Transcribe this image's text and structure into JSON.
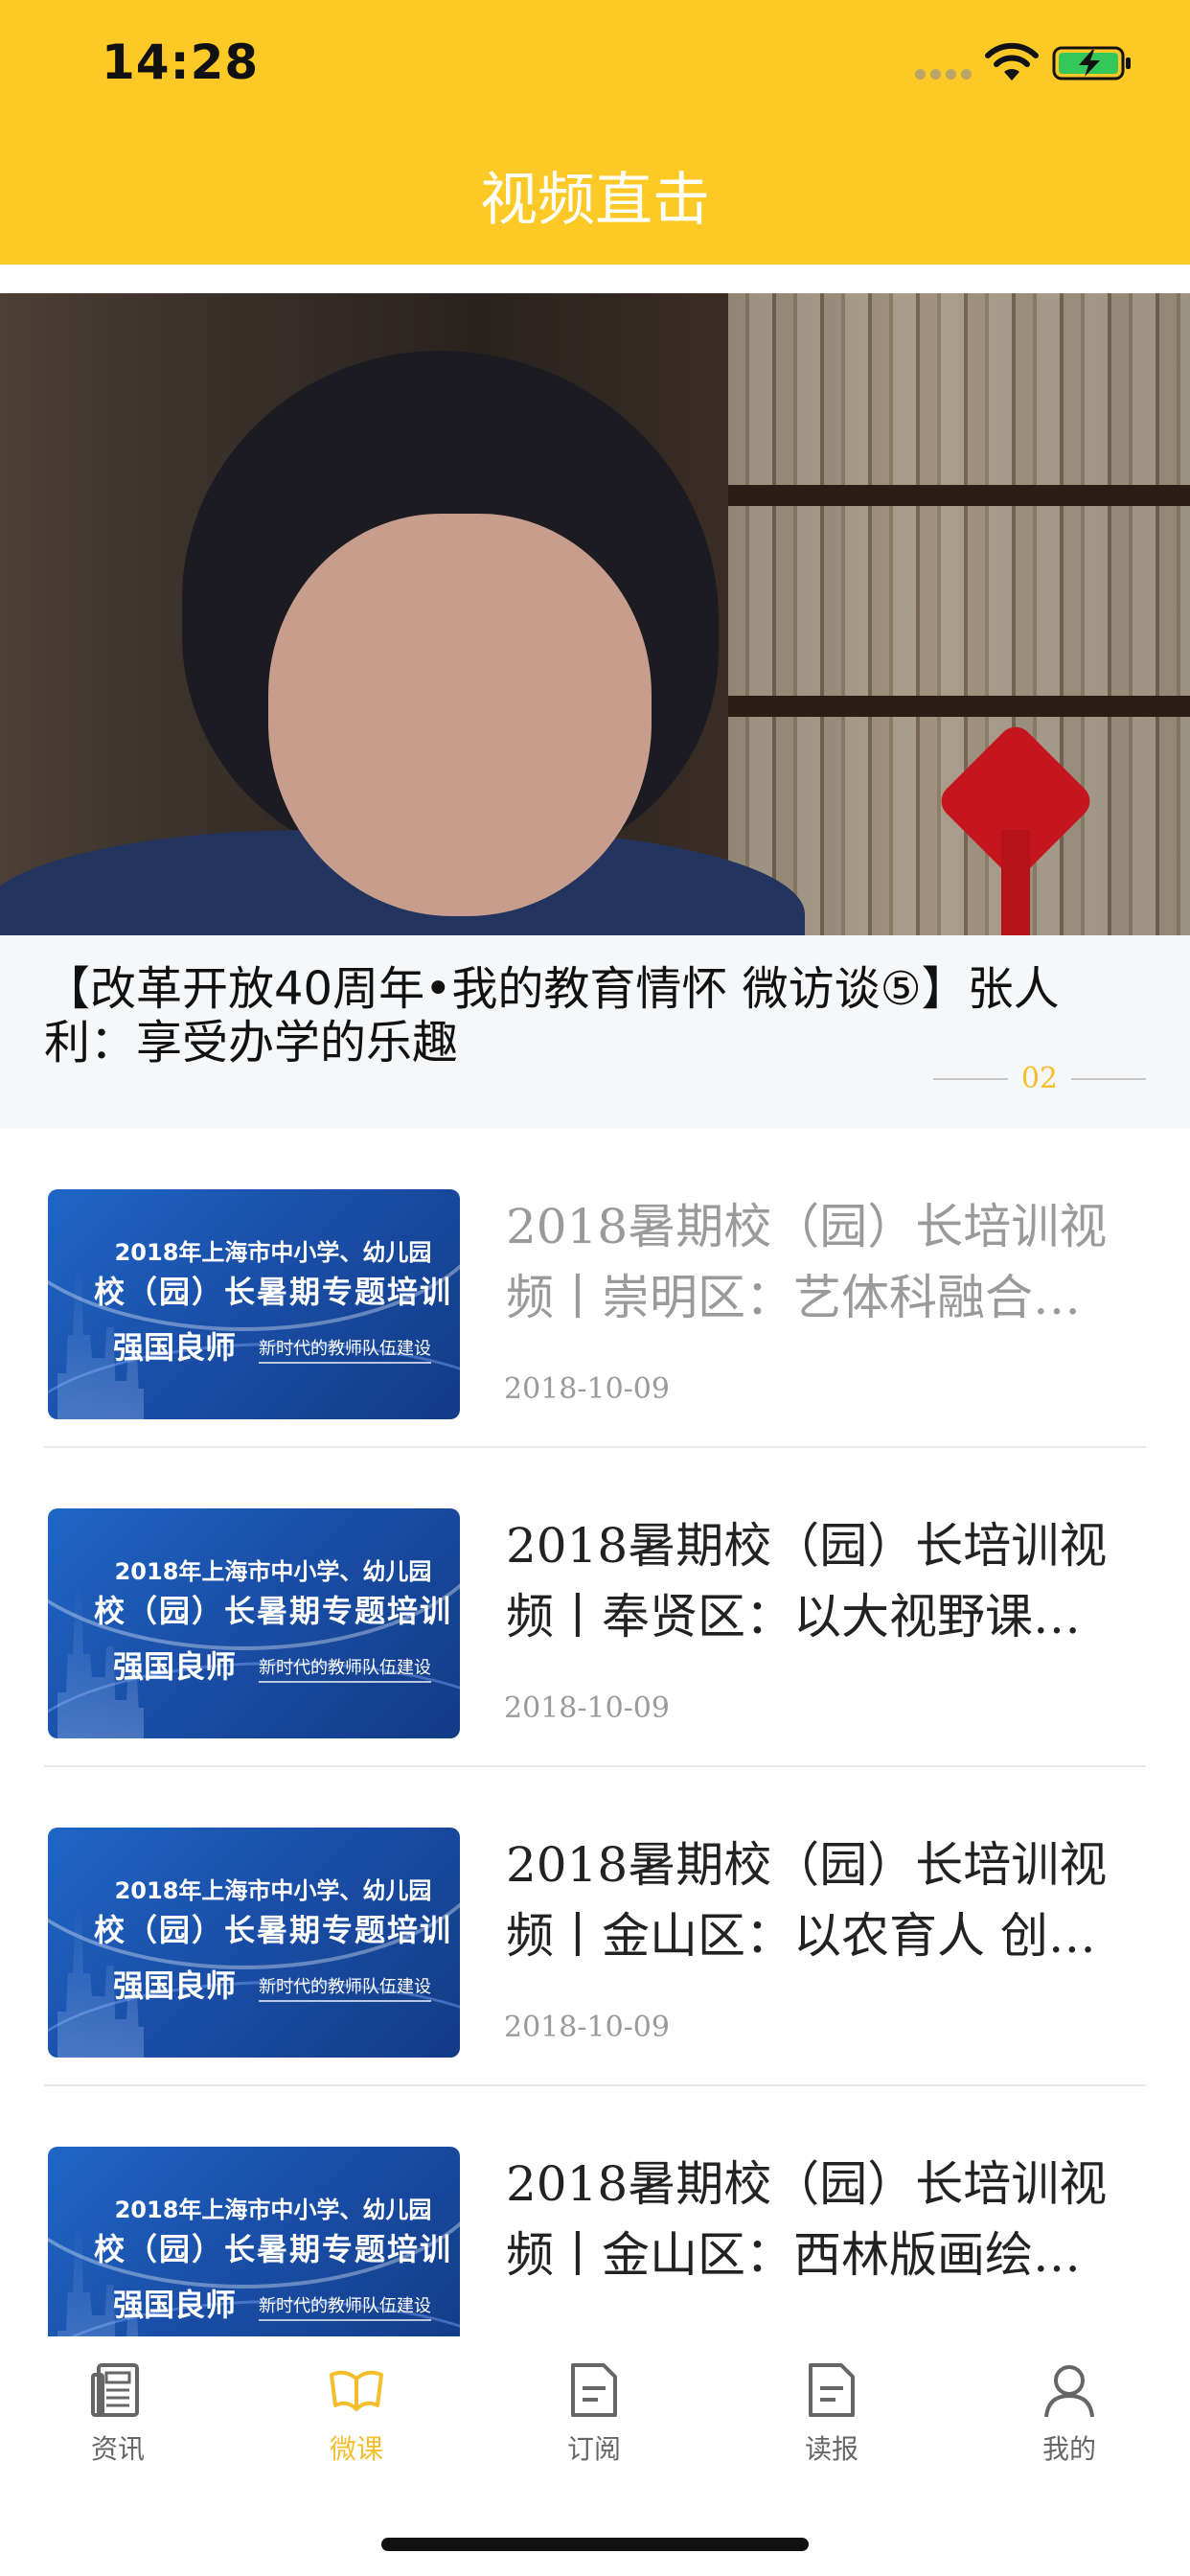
{
  "status_bar": {
    "time": "14:28"
  },
  "header": {
    "title": "视频直击"
  },
  "featured": {
    "title": "【改革开放40周年•我的教育情怀 微访谈⑤】张人利：享受办学的乐趣",
    "page_number": "02"
  },
  "thumbnail": {
    "line1": "2018年上海市中小学、幼儿园",
    "line2": "校（园）长暑期专题培训",
    "line3": "强国良师",
    "line4": "新时代的教师队伍建设"
  },
  "list": [
    {
      "title_line1": "2018暑期校（园）长培训视",
      "title_line2": "频丨崇明区：艺体科融合…",
      "date": "2018-10-09",
      "read": true
    },
    {
      "title_line1": "2018暑期校（园）长培训视",
      "title_line2": "频丨奉贤区：以大视野课…",
      "date": "2018-10-09",
      "read": false
    },
    {
      "title_line1": "2018暑期校（园）长培训视",
      "title_line2": "频丨金山区：以农育人 创…",
      "date": "2018-10-09",
      "read": false
    },
    {
      "title_line1": "2018暑期校（园）长培训视",
      "title_line2": "频丨金山区：西林版画绘…",
      "date": "",
      "read": false
    }
  ],
  "tabs": [
    {
      "label": "资讯",
      "icon": "newspaper-icon",
      "active": false
    },
    {
      "label": "微课",
      "icon": "open-book-icon",
      "active": true
    },
    {
      "label": "订阅",
      "icon": "document-icon",
      "active": false
    },
    {
      "label": "读报",
      "icon": "document-icon",
      "active": false
    },
    {
      "label": "我的",
      "icon": "person-icon",
      "active": false
    }
  ],
  "colors": {
    "brand_yellow": "#FDC926",
    "active_tab": "#F4BD2C"
  }
}
